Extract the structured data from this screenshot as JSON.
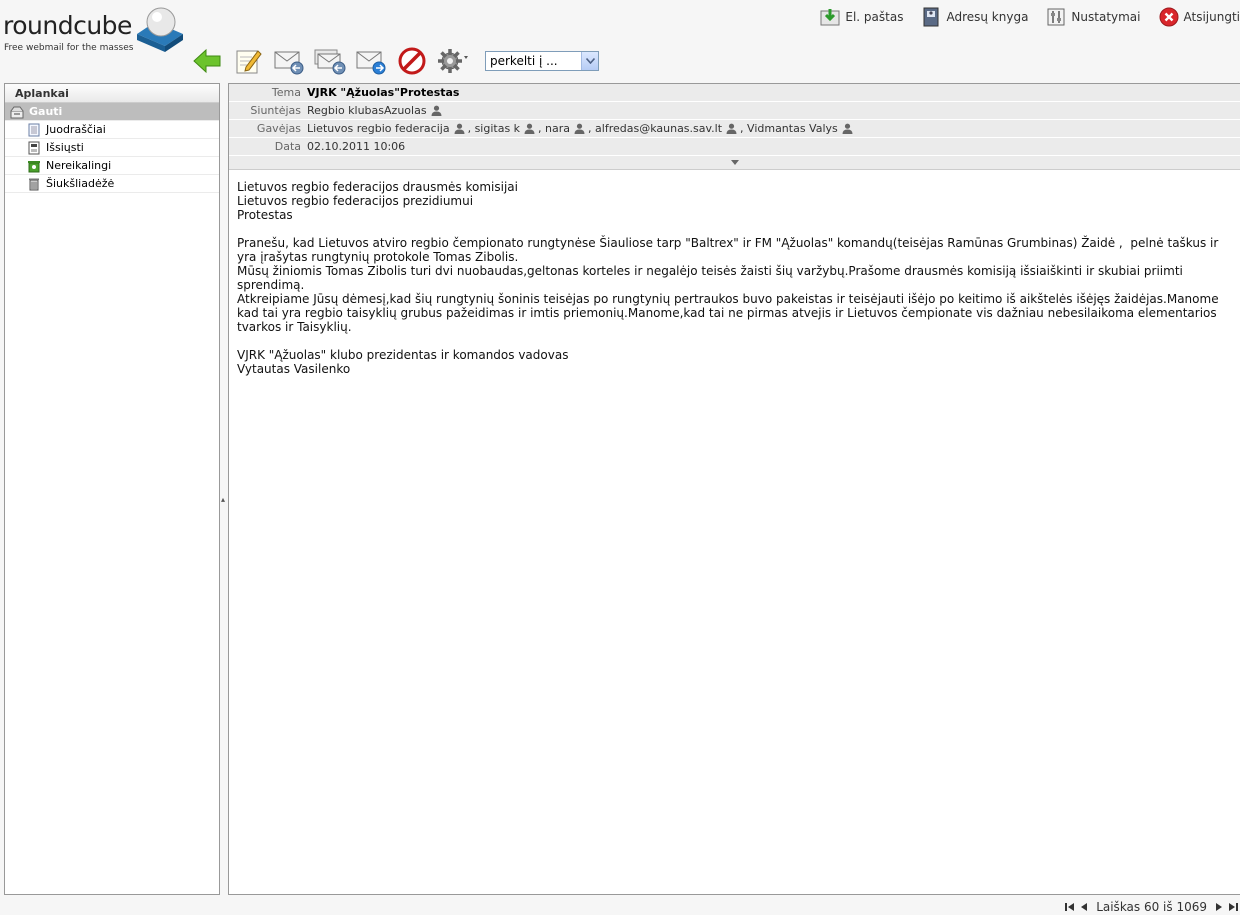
{
  "logo": {
    "name": "roundcube",
    "tagline": "Free webmail for the masses"
  },
  "topnav": [
    {
      "label": "El. paštas",
      "icon": "mail-download-icon"
    },
    {
      "label": "Adresų knyga",
      "icon": "address-book-icon"
    },
    {
      "label": "Nustatymai",
      "icon": "settings-icon"
    },
    {
      "label": "Atsijungti",
      "icon": "logout-icon"
    }
  ],
  "toolbar": {
    "move_select": "perkelti į ..."
  },
  "folders": {
    "header": "Aplankai",
    "items": [
      {
        "label": "Gauti",
        "icon": "inbox-icon"
      },
      {
        "label": "Juodraščiai",
        "icon": "drafts-icon"
      },
      {
        "label": "Išsiųsti",
        "icon": "sent-icon"
      },
      {
        "label": "Nereikalingi",
        "icon": "junk-icon"
      },
      {
        "label": "Šiukšliadėžė",
        "icon": "trash-icon"
      }
    ]
  },
  "message": {
    "labels": {
      "subject": "Tema",
      "from": "Siuntėjas",
      "to": "Gavėjas",
      "date": "Data"
    },
    "subject": "VJRK \"Ąžuolas\"Protestas",
    "from": "Regbio klubasAzuolas",
    "to": [
      "Lietuvos regbio federacija",
      "sigitas k",
      "nara",
      "alfredas@kaunas.sav.lt",
      "Vidmantas Valys"
    ],
    "date": "02.10.2011 10:06",
    "body": [
      "Lietuvos regbio federacijos drausmės komisijai",
      "Lietuvos regbio federacijos prezidiumui",
      "Protestas",
      "",
      "Pranešu, kad Lietuvos atviro regbio čempionato rungtynėse Šiauliose tarp \"Baltrex\" ir FM \"Ąžuolas\" komandų(teisėjas Ramūnas Grumbinas) Žaidė ,  pelnė taškus ir yra įrašytas rungtynių protokole Tomas Zibolis.",
      "Mūsų žiniomis Tomas Zibolis turi dvi nuobaudas,geltonas korteles ir negalėjo teisės žaisti šių varžybų.Prašome drausmės komisiją išsiaiškinti ir skubiai priimti sprendimą.",
      "Atkreipiame Jūsų dėmesį,kad šių rungtynių šoninis teisėjas po rungtynių pertraukos buvo pakeistas ir teisėjauti išėjo po keitimo iš aikštelės išėjęs žaidėjas.Manome kad tai yra regbio taisyklių grubus pažeidimas ir imtis priemonių.Manome,kad tai ne pirmas atvejis ir Lietuvos čempionate vis dažniau nebesilaikoma elementarios tvarkos ir Taisyklių.",
      "",
      "VJRK \"Ąžuolas\" klubo prezidentas ir komandos vadovas",
      "Vytautas Vasilenko"
    ]
  },
  "footer": {
    "count_text": "Laiškas 60 iš 1069"
  }
}
